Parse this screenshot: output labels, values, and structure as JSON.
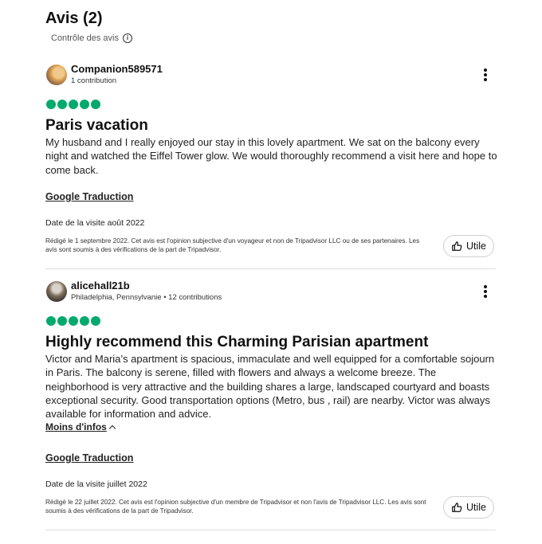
{
  "header": {
    "title": "Avis (2)",
    "control_label": "Contrôle des avis"
  },
  "reviews": [
    {
      "username": "Companion589571",
      "meta": "1 contribution",
      "rating": 5,
      "title": "Paris vacation",
      "body": "My husband and I really enjoyed our stay in this lovely apartment. We sat on the balcony every night and watched the Eiffel Tower glow. We would thoroughly recommend a visit here and hope to come back.",
      "translate_label": "Google Traduction",
      "visit_date": "Date de la visite août 2022",
      "disclaimer": "Rédigé le 1 septembre 2022. Cet avis est l'opinion subjective d'un voyageur et non de Tripadvisor LLC ou de ses partenaires. Les avis sont soumis à des vérifications de la part de Tripadvisor.",
      "helpful_label": "Utile"
    },
    {
      "username": "alicehall21b",
      "meta": "Philadelphia, Pennsylvanie • 12 contributions",
      "rating": 5,
      "title": "Highly recommend this Charming Parisian apartment",
      "body": "Victor and Maria’s apartment is spacious, immaculate and well equipped for a comfortable sojourn in Paris. The balcony is serene, filled with flowers and always a welcome breeze. The neighborhood is very attractive and the building shares a large, landscaped courtyard and boasts exceptional security. Good transportation options (Metro, bus , rail) are nearby. Victor was always available for information and advice.",
      "less_label": "Moins d'infos",
      "translate_label": "Google Traduction",
      "visit_date": "Date de la visite juillet 2022",
      "disclaimer": "Rédigé le 22 juillet 2022. Cet avis est l'opinion subjective d'un membre de Tripadvisor et non l'avis de Tripadvisor LLC. Les avis sont soumis à des vérifications de la part de Tripadvisor.",
      "helpful_label": "Utile"
    }
  ]
}
